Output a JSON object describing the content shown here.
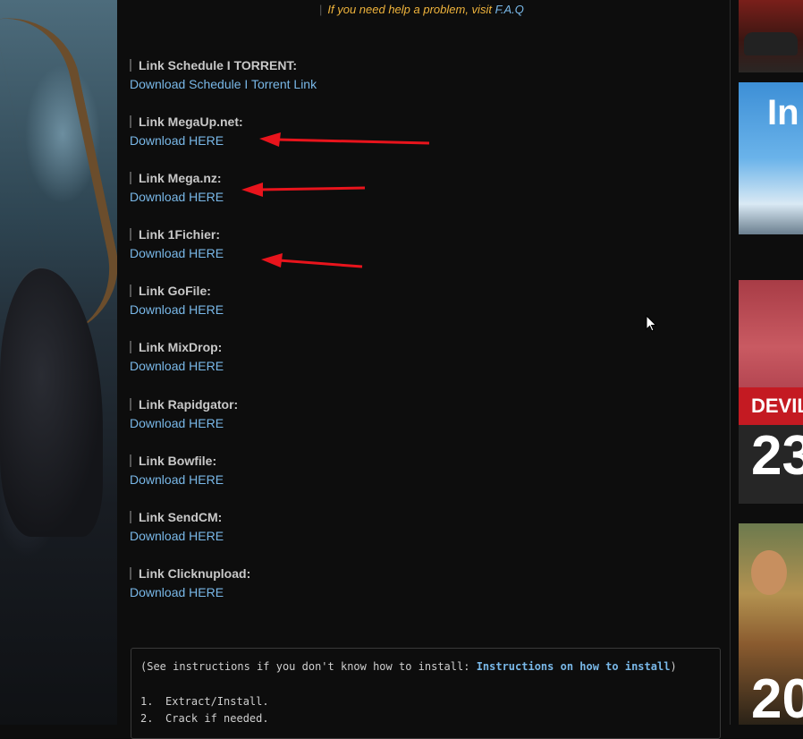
{
  "help_line": {
    "text": "If you need help a problem, visit",
    "faq_label": "F.A.Q"
  },
  "download_links": [
    {
      "title": "Link Schedule I TORRENT:",
      "link_label": "Download Schedule I Torrent Link"
    },
    {
      "title": "Link MegaUp.net:",
      "link_label": "Download HERE"
    },
    {
      "title": "Link Mega.nz:",
      "link_label": "Download HERE"
    },
    {
      "title": "Link 1Fichier:",
      "link_label": "Download HERE"
    },
    {
      "title": "Link GoFile:",
      "link_label": "Download HERE"
    },
    {
      "title": "Link MixDrop:",
      "link_label": "Download HERE"
    },
    {
      "title": "Link Rapidgator:",
      "link_label": "Download HERE"
    },
    {
      "title": "Link Bowfile:",
      "link_label": "Download HERE"
    },
    {
      "title": "Link SendCM:",
      "link_label": "Download HERE"
    },
    {
      "title": "Link Clicknupload:",
      "link_label": "Download HERE"
    }
  ],
  "instructions": {
    "prefix": "(See instructions if you don't know how to install: ",
    "link_label": "Instructions on how to install",
    "suffix": ")",
    "steps": [
      {
        "num": "1.",
        "text": "Extract/Install."
      },
      {
        "num": "2.",
        "text": "Crack if needed."
      }
    ]
  },
  "sidebar_ads": {
    "thumb2_logo": "In",
    "thumb3_banner": "DEVIL M",
    "thumb3_number": "23",
    "thumb4_number": "20"
  },
  "colors": {
    "background": "#0d0d0d",
    "link": "#79b8e8",
    "help_text": "#f0b43c",
    "arrow": "#e8141c"
  },
  "icons": [
    "arrow-annotation-icon",
    "mouse-cursor-icon"
  ]
}
